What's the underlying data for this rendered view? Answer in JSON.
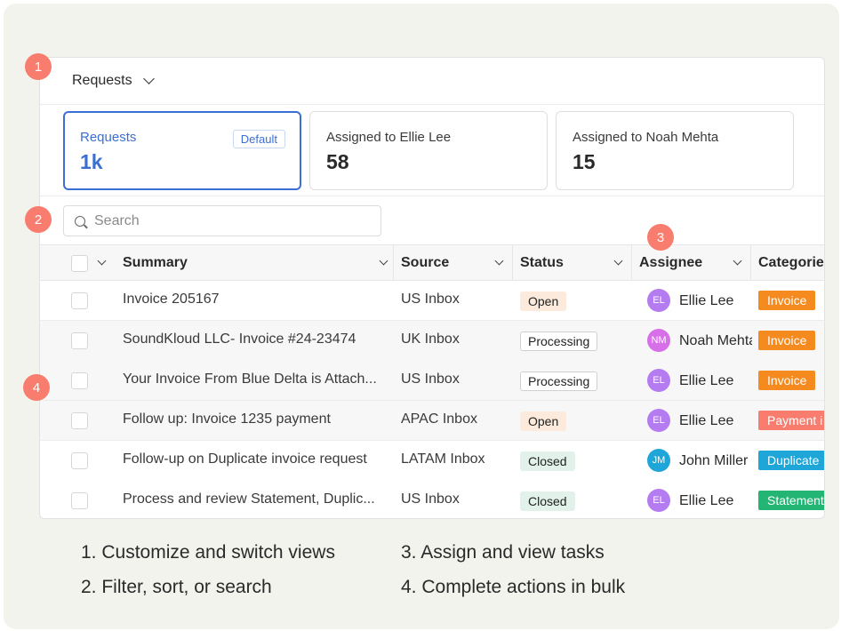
{
  "views_menu": {
    "label": "Requests"
  },
  "cards": [
    {
      "label": "Requests",
      "count": "1k",
      "tag": "Default"
    },
    {
      "label": "Assigned to Ellie Lee",
      "count": "58"
    },
    {
      "label": "Assigned to Noah Mehta",
      "count": "15"
    }
  ],
  "search": {
    "placeholder": "Search"
  },
  "columns": {
    "summary": "Summary",
    "source": "Source",
    "status": "Status",
    "assignee": "Assignee",
    "categories": "Categorie"
  },
  "rows": [
    {
      "summary": "Invoice 205167",
      "source": "US Inbox",
      "status": "Open",
      "initials": "EL",
      "assignee": "Ellie Lee",
      "category": "Invoice"
    },
    {
      "summary": "SoundKloud LLC- Invoice #24-23474",
      "source": "UK Inbox",
      "status": "Processing",
      "initials": "NM",
      "assignee": "Noah Mehta",
      "category": "Invoice"
    },
    {
      "summary": "Your Invoice From Blue Delta is Attach...",
      "source": "US Inbox",
      "status": "Processing",
      "initials": "EL",
      "assignee": "Ellie Lee",
      "category": "Invoice"
    },
    {
      "summary": "Follow up: Invoice 1235 payment",
      "source": "APAC Inbox",
      "status": "Open",
      "initials": "EL",
      "assignee": "Ellie Lee",
      "category": "Payment i"
    },
    {
      "summary": "Follow-up on Duplicate invoice request",
      "source": "LATAM Inbox",
      "status": "Closed",
      "initials": "JM",
      "assignee": "John Miller",
      "category": "Duplicate"
    },
    {
      "summary": "Process and review Statement, Duplic...",
      "source": "US Inbox",
      "status": "Closed",
      "initials": "EL",
      "assignee": "Ellie Lee",
      "category": "Statement"
    }
  ],
  "markers": [
    "1",
    "2",
    "3",
    "4"
  ],
  "legend": [
    "1. Customize and switch views",
    "3. Assign and view tasks",
    "2. Filter, sort, or search",
    "4. Complete actions in bulk"
  ],
  "colors": {
    "accent": "#3b6fd4",
    "marker": "#f87d6f",
    "avatar_el": "#b57bf0",
    "avatar_nm": "#d66fe8",
    "avatar_jm": "#1fa6d9",
    "cat_invoice": "#f58a1f",
    "cat_payment": "#f87d6f",
    "cat_duplicate": "#1fa6d9",
    "cat_statement": "#22b573"
  }
}
